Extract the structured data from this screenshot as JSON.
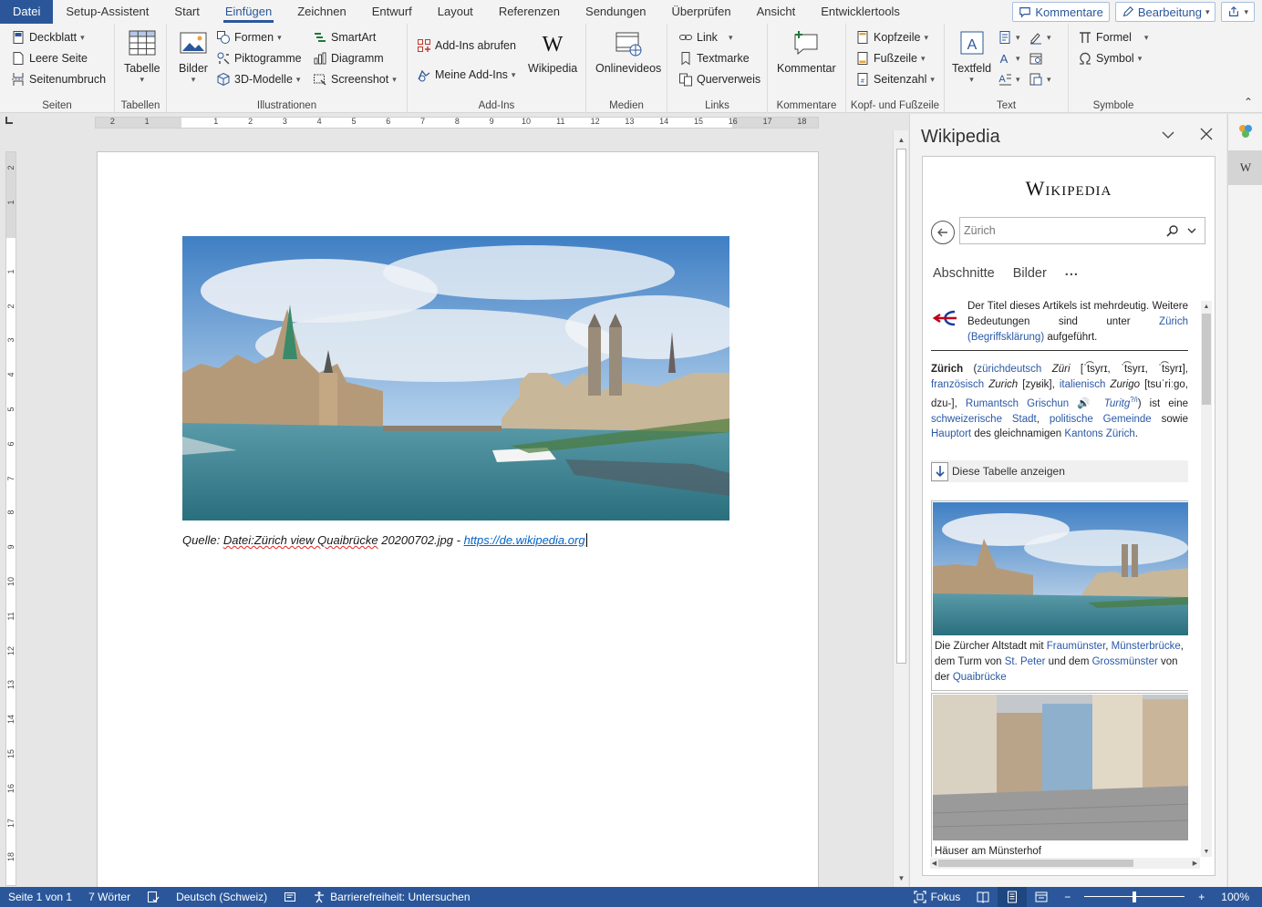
{
  "tabs": [
    {
      "label": "Datei",
      "kind": "file"
    },
    {
      "label": "Setup-Assistent"
    },
    {
      "label": "Start"
    },
    {
      "label": "Einfügen",
      "active": true
    },
    {
      "label": "Zeichnen"
    },
    {
      "label": "Entwurf"
    },
    {
      "label": "Layout"
    },
    {
      "label": "Referenzen"
    },
    {
      "label": "Sendungen"
    },
    {
      "label": "Überprüfen"
    },
    {
      "label": "Ansicht"
    },
    {
      "label": "Entwicklertools"
    }
  ],
  "tab_right": {
    "comment_label": "Kommentare",
    "edit_label": "Bearbeitung"
  },
  "ribbon": {
    "seiten": {
      "label": "Seiten",
      "deckblatt": "Deckblatt",
      "leere_seite": "Leere Seite",
      "seitenumbruch": "Seitenumbruch"
    },
    "tabellen": {
      "label": "Tabellen",
      "tabelle": "Tabelle"
    },
    "illustrationen": {
      "label": "Illustrationen",
      "bilder": "Bilder",
      "formen": "Formen",
      "piktogramme": "Piktogramme",
      "modelle": "3D-Modelle",
      "smartart": "SmartArt",
      "diagramm": "Diagramm",
      "screenshot": "Screenshot"
    },
    "addins": {
      "label": "Add-Ins",
      "abrufen": "Add-Ins abrufen",
      "meine": "Meine Add-Ins",
      "wikipedia": "Wikipedia"
    },
    "medien": {
      "label": "Medien",
      "onlinevideos": "Onlinevideos"
    },
    "links": {
      "label": "Links",
      "link": "Link",
      "textmarke": "Textmarke",
      "querverweis": "Querverweis"
    },
    "kommentare": {
      "label": "Kommentare",
      "kommentar": "Kommentar"
    },
    "kopf": {
      "label": "Kopf- und Fußzeile",
      "kopfzeile": "Kopfzeile",
      "fusszeile": "Fußzeile",
      "seitenzahl": "Seitenzahl"
    },
    "text": {
      "label": "Text",
      "textfeld": "Textfeld"
    },
    "symbole": {
      "label": "Symbole",
      "formel": "Formel",
      "symbol": "Symbol"
    }
  },
  "ruler_h": [
    "2",
    "1",
    "1",
    "2",
    "3",
    "4",
    "5",
    "6",
    "7",
    "8",
    "9",
    "10",
    "11",
    "12",
    "13",
    "14",
    "15",
    "16",
    "17",
    "18"
  ],
  "ruler_v": [
    "2",
    "1",
    "1",
    "2",
    "3",
    "4",
    "5",
    "6",
    "7",
    "8",
    "9",
    "10",
    "11",
    "12",
    "13",
    "14",
    "15",
    "16",
    "17",
    "18"
  ],
  "document": {
    "caption_prefix": "Quelle: ",
    "caption_file": "Datei:Zürich view Quaibrücke",
    "caption_mid": " 20200702.jpg - ",
    "caption_link": "https://de.wikipedia.org"
  },
  "pane": {
    "title": "Wikipedia",
    "logo": "Wikipedia",
    "search_placeholder": "Zürich",
    "tabs": {
      "abschnitte": "Abschnitte",
      "bilder": "Bilder",
      "more": "..."
    },
    "ambig_text": "Der Titel dieses Artikels ist mehrdeutig. Weitere Bedeutungen sind unter",
    "ambig_link": "Zürich (Begriffsklärung)",
    "ambig_end": " aufgeführt.",
    "intro": {
      "title": "Zürich",
      "p1": " (",
      "l1": "zürichdeutsch",
      "t1": " ",
      "i1": "Züri",
      "t2": " [ˈt͡syrɪ, ˈt͡syrɪ, ˈt͡syrɪ], ",
      "l2": "französisch",
      "t3": " ",
      "i2": "Zurich",
      "t4": " [zyʁik], ",
      "l3": "italienisch",
      "t5": " ",
      "i3": "Zurigo",
      "t6": " [tsuˈriːgo, dzu-], ",
      "l4": "Rumantsch Grischun",
      "t7": " 🔊 ",
      "i4": "Turitg",
      "sup": "?/i",
      "t8": ") ist eine ",
      "l5": "schweizerische Stadt",
      "t9": ", ",
      "l6": "politische Gemeinde",
      "t10": " sowie ",
      "l7": "Hauptort",
      "t11": " des gleichnamigen ",
      "l8": "Kantons Zürich",
      "t12": "."
    },
    "table_toggle": "Diese Tabelle anzeigen",
    "thumb1": {
      "c1": "Die Zürcher Altstadt mit ",
      "l1": "Fraumünster",
      "c2": ", ",
      "l2": "Münsterbrücke",
      "c3": ", dem Turm von ",
      "l3": "St. Peter",
      "c4": " und dem ",
      "l4": "Grossmünster",
      "c5": " von der ",
      "l5": "Quaibrücke"
    },
    "thumb2": {
      "caption": "Häuser am Münsterhof"
    }
  },
  "statusbar": {
    "page": "Seite 1 von 1",
    "words": "7 Wörter",
    "language": "Deutsch (Schweiz)",
    "accessibility": "Barrierefreiheit: Untersuchen",
    "focus": "Fokus",
    "zoom_minus": "−",
    "zoom_plus": "+",
    "zoom": "100%",
    "zoom_fraction": 0.5
  },
  "colors": {
    "accent": "#2b579a",
    "link": "#0563c1",
    "wiki_link": "#2a58a6"
  }
}
